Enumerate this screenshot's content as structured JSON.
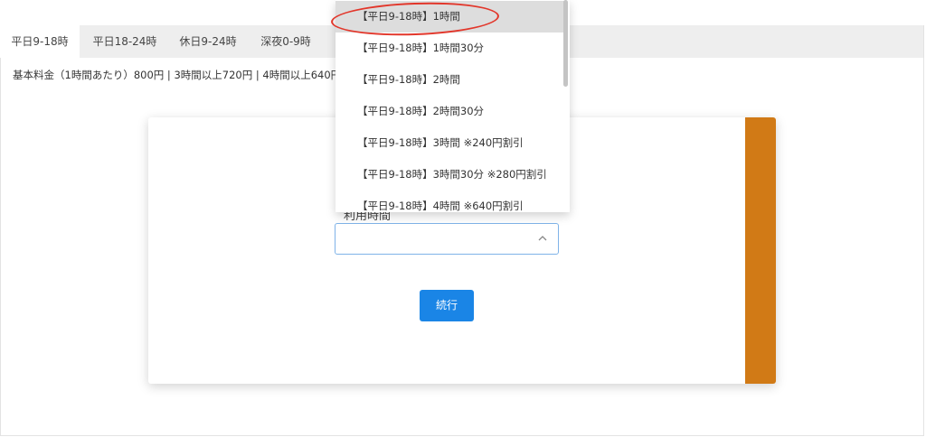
{
  "tabs": [
    "平日9-18時",
    "平日18-24時",
    "休日9-24時",
    "深夜0-9時"
  ],
  "rates_text": "基本料金（1時間あたり）800円 | 3時間以上720円 | 4時間以上640円",
  "form": {
    "label": "利用時間",
    "select_value": "",
    "submit_label": "続行"
  },
  "dropdown_options": [
    "【平日9-18時】1時間",
    "【平日9-18時】1時間30分",
    "【平日9-18時】2時間",
    "【平日9-18時】2時間30分",
    "【平日9-18時】3時間 ※240円割引",
    "【平日9-18時】3時間30分 ※280円割引",
    "【平日9-18時】4時間 ※640円割引"
  ],
  "highlighted_option_index": 0,
  "colors": {
    "accent": "#d17a16",
    "button": "#1a85e6",
    "annotation": "#e2362a"
  }
}
